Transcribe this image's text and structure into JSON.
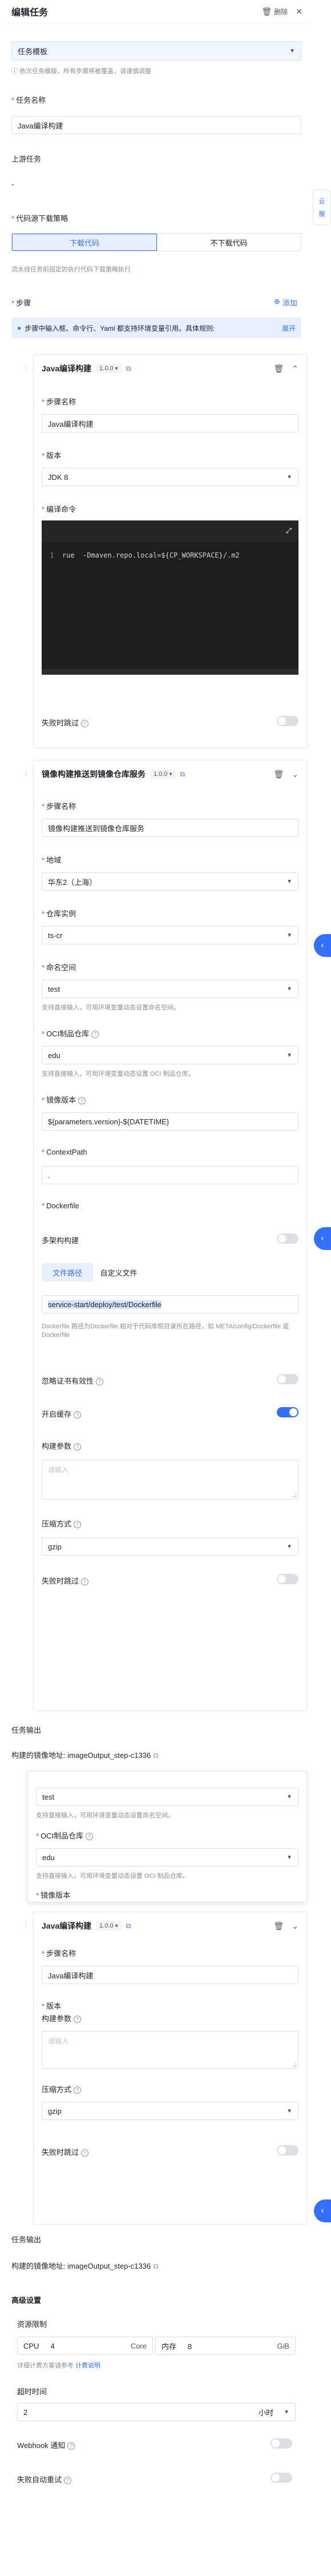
{
  "header": {
    "title": "编辑任务",
    "delete_label": "删除"
  },
  "template": {
    "label": "任务模板",
    "hint": "依次任务模版，所有步骤将被覆盖，请谨慎调整"
  },
  "task_name": {
    "label": "任务名称",
    "value": "Java编译构建"
  },
  "upstream": {
    "label": "上游任务",
    "value": "-"
  },
  "code_source": {
    "label": "代码源下载策略",
    "options": [
      "下载代码",
      "不下载代码"
    ],
    "hint": "流水线任务前固定的执行代码下载策略执行"
  },
  "steps_section": {
    "label": "步骤",
    "add_label": "添加",
    "info": "步骤中输入框、命令行、Yaml 都支持环境变量引用。具体规则:",
    "expand": "展开"
  },
  "step1": {
    "title": "Java编译构建",
    "version": "1.0.0",
    "name_label": "步骤名称",
    "name_value": "Java编译构建",
    "jdk_label": "版本",
    "jdk_value": "JDK 8",
    "cmd_label": "编译命令",
    "cmd_line_no": "1",
    "cmd_text": "rue  -Dmaven.repo.local=${CP_WORKSPACE}/.m2",
    "fail_label": "失败时跳过"
  },
  "step2": {
    "title": "镜像构建推送到镜像仓库服务",
    "version": "1.0.0",
    "name_label": "步骤名称",
    "name_value": "镜像构建推送到镜像仓库服务",
    "region_label": "地域",
    "region_value": "华东2（上海）",
    "instance_label": "仓库实例",
    "instance_value": "ts-cr",
    "ns_label": "命名空间",
    "ns_value": "test",
    "ns_hint": "支持直接输入，可用环境变量动态设置命名空间。",
    "repo_label": "OCI制品仓库",
    "repo_value": "edu",
    "repo_hint": "支持直接输入，可用环境变量动态设置 OCI 制品仓库。",
    "tag_label": "镜像版本",
    "tag_value": "${parameters.version}-${DATETIME}",
    "ctx_label": "ContextPath",
    "ctx_value": ".",
    "df_label": "Dockerfile",
    "multi_label": "多架构构建",
    "df_tabs": [
      "文件路径",
      "自定义文件"
    ],
    "df_path": "service-start/deploy/test/Dockerfile",
    "df_hint": "Dockerfile 路径为Dockerfile 相对于代码库根目录所在路径，如 META/config/Dockerfile 或 Dockerfile",
    "cert_label": "忽略证书有效性",
    "cache_label": "开启缓存",
    "args_label": "构建参数",
    "args_placeholder": "请输入",
    "compress_label": "压缩方式",
    "compress_value": "gzip",
    "fail_label": "失败时跳过"
  },
  "output1": {
    "label": "任务输出",
    "value": "构建的镜像地址: imageOutput_step-c1336"
  },
  "floating": {
    "ns_value": "test",
    "ns_hint": "支持直接输入，可用环境变量动态设置命名空间。",
    "repo_label": "OCI制品仓库",
    "repo_value": "edu",
    "repo_hint": "支持直接输入，可用环境变量动态设置 OCI 制品仓库。",
    "tag_label": "镜像版本"
  },
  "step3": {
    "title": "Java编译构建",
    "version": "1.0.0",
    "name_label": "步骤名称",
    "name_value": "Java编译构建",
    "ver_label": "版本",
    "args_label": "构建参数",
    "args_placeholder": "请输入",
    "compress_label": "压缩方式",
    "compress_value": "gzip",
    "fail_label": "失败时跳过"
  },
  "output2": {
    "label": "任务输出",
    "value": "构建的镜像地址: imageOutput_step-c1336"
  },
  "advanced": {
    "label": "高级设置",
    "res_label": "资源限制",
    "cpu_label": "CPU",
    "cpu_value": "4",
    "cpu_unit": "Core",
    "mem_label": "内存",
    "mem_value": "8",
    "mem_unit": "GiB",
    "billing_hint": "详细计费方案请参考",
    "billing_link": "计费说明",
    "timeout_label": "超时时间",
    "timeout_value": "2",
    "timeout_unit": "小时",
    "webhook_label": "Webhook 通知",
    "retry_label": "失败自动重试"
  },
  "side": {
    "chat1": "云",
    "chat2": "服"
  }
}
